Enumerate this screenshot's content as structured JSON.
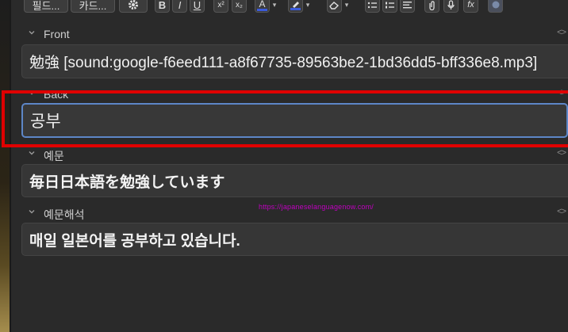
{
  "toolbar": {
    "fields_button": "필드...",
    "cards_button": "카드...",
    "bold": "B",
    "italic": "I",
    "underline": "U",
    "superscript": "x²",
    "subscript": "x₂",
    "text_color": "A",
    "function_label": "fx"
  },
  "colors": {
    "text_color_bar": "#3b5bdb",
    "highlight_bar": "#3b5bdb",
    "active_border": "#5d86c7",
    "annotation_red": "#e00000",
    "watermark": "#c000c0"
  },
  "fields": [
    {
      "label": "Front",
      "value": "勉強 [sound:google-f6eed111-a8f67735-89563be2-1bd36dd5-bff336e8.mp3]"
    },
    {
      "label": "Back",
      "value": "공부"
    },
    {
      "label": "예문",
      "value": "毎日日本語を勉強しています"
    },
    {
      "label": "예문해석",
      "value": "매일 일본어를 공부하고 있습니다."
    }
  ],
  "watermark": "https://japaneselanguagenow.com/"
}
